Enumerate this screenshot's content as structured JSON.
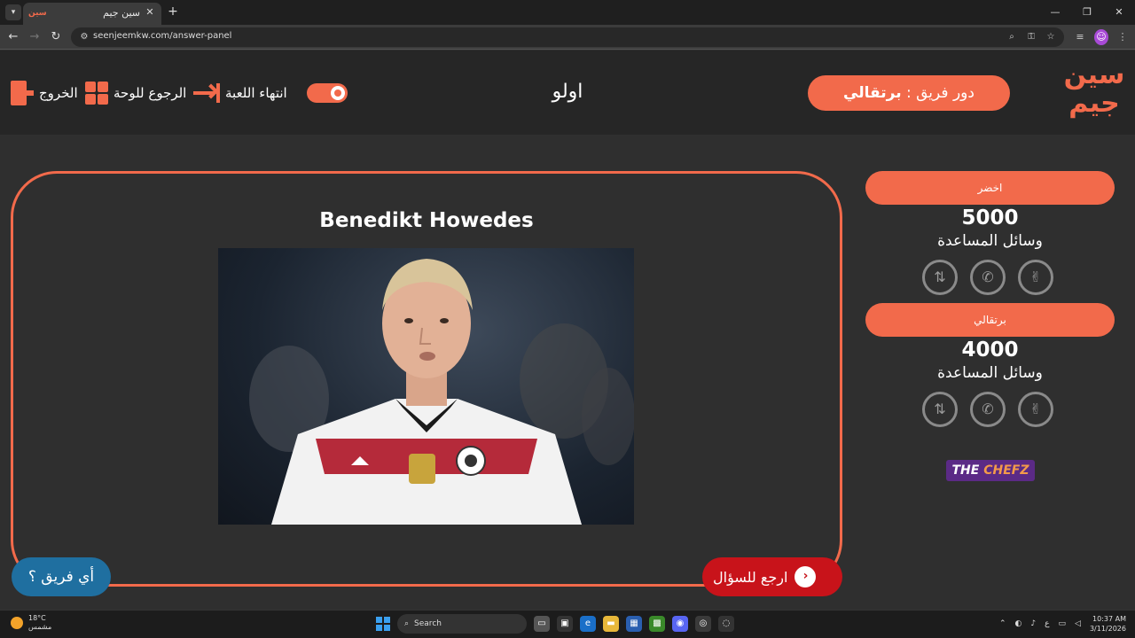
{
  "browser": {
    "tab_title": "سين جيم",
    "favicon_text": "سين",
    "url": "seenjeemkw.com/answer-panel",
    "window_controls": [
      "—",
      "❐",
      "✕"
    ]
  },
  "header": {
    "logo_line1": "سين",
    "logo_line2": "جيم",
    "turn_prefix": "دور فريق : ",
    "turn_team": "برتقالي",
    "word": "اولو",
    "end_game_label": "انتهاء اللعبة",
    "back_to_board_label": "الرجوع للوحة",
    "exit_label": "الخروج"
  },
  "question": {
    "answer": "Benedikt Howedes",
    "return_button": "ارجع للسؤال",
    "which_team_button": "أي فريق ؟"
  },
  "teams": [
    {
      "name": "اخضر",
      "score": "5000",
      "helpers_label": "وسائل المساعدة"
    },
    {
      "name": "برتقالي",
      "score": "4000",
      "helpers_label": "وسائل المساعدة"
    }
  ],
  "helper_icons": [
    "swap-icon",
    "phone-icon",
    "peace-hand-icon"
  ],
  "sponsor": {
    "part1": "THE ",
    "part2": "CHEFZ"
  },
  "taskbar": {
    "temperature": "18°C",
    "weather": "مشمس",
    "search": "Search",
    "time": "10:37 AM",
    "date": "3/11/2026",
    "lang": "ع"
  },
  "colors": {
    "accent": "#f26a4b",
    "return": "#c8131a",
    "which": "#1f6fa0",
    "bg": "#2f2f2f"
  }
}
